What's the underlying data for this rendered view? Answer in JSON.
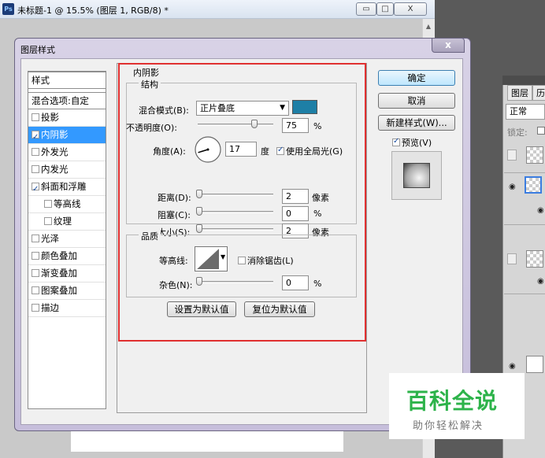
{
  "document_window": {
    "app_badge": "Ps",
    "title": "未标题-1 @ 15.5% (图层 1, RGB/8) *",
    "minimize": "▭",
    "maximize": "□",
    "close": "X",
    "scroll_up": "▲"
  },
  "layers_panel": {
    "tabs": [
      "图层",
      "历"
    ],
    "blend_mode": "正常",
    "lock_label": "锁定:"
  },
  "dialog": {
    "title": "图层样式",
    "close": "x",
    "style_list": [
      {
        "label": "样式",
        "type": "header"
      },
      {
        "label": "混合选项:自定",
        "type": "header"
      },
      {
        "label": "投影",
        "checked": false
      },
      {
        "label": "内阴影",
        "checked": true,
        "selected": true
      },
      {
        "label": "外发光",
        "checked": false
      },
      {
        "label": "内发光",
        "checked": false
      },
      {
        "label": "斜面和浮雕",
        "checked": true
      },
      {
        "label": "等高线",
        "checked": false,
        "indent": true
      },
      {
        "label": "纹理",
        "checked": false,
        "indent": true
      },
      {
        "label": "光泽",
        "checked": false
      },
      {
        "label": "颜色叠加",
        "checked": false
      },
      {
        "label": "渐变叠加",
        "checked": false
      },
      {
        "label": "图案叠加",
        "checked": false
      },
      {
        "label": "描边",
        "checked": false
      }
    ],
    "panel_title": "内阴影",
    "structure": {
      "title": "结构",
      "blend_mode_label": "混合模式(B):",
      "blend_mode_value": "正片叠底",
      "color_swatch": "#1e7fa6",
      "opacity_label": "不透明度(O):",
      "opacity_value": "75",
      "opacity_unit": "%",
      "opacity_level": 0.75,
      "angle_label": "角度(A):",
      "angle_value": "17",
      "angle_unit": "度",
      "global_light_label": "使用全局光(G)",
      "global_light_checked": true,
      "distance_label": "距离(D):",
      "distance_value": "2",
      "distance_unit": "像素",
      "choke_label": "阻塞(C):",
      "choke_value": "0",
      "choke_unit": "%",
      "size_label": "大小(S):",
      "size_value": "2",
      "size_unit": "像素"
    },
    "quality": {
      "title": "品质",
      "contour_label": "等高线:",
      "anti_alias_label": "消除锯齿(L)",
      "anti_alias_checked": false,
      "noise_label": "杂色(N):",
      "noise_value": "0",
      "noise_unit": "%"
    },
    "buttons": {
      "set_default": "设置为默认值",
      "reset_default": "复位为默认值",
      "ok": "确定",
      "cancel": "取消",
      "new_style": "新建样式(W)...",
      "preview_label": "预览(V)",
      "preview_checked": true
    }
  },
  "watermark": {
    "title": "百科全说",
    "subtitle": "助你轻松解决"
  },
  "colors": {
    "selection": "#3399ff",
    "highlight_frame": "#e03030",
    "watermark_green": "#2db34a"
  }
}
